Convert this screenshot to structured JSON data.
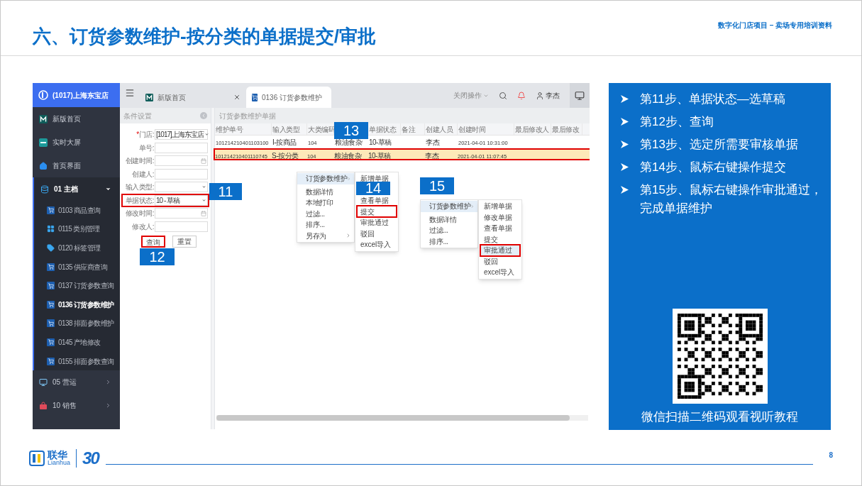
{
  "title": "六、订货参数维护-按分类的单据提交/审批",
  "header_note": "数字化门店项目 – 卖场专用培训资料",
  "screen": {
    "sidebar": {
      "store": "(1017)上海东宝店",
      "items": [
        {
          "label": "新版首页",
          "kind": "m"
        },
        {
          "label": "实时大屏",
          "kind": "screen"
        },
        {
          "label": "首页界面",
          "kind": "home"
        },
        {
          "label": "01 主档",
          "kind": "database",
          "expanded": true,
          "children": [
            {
              "label": "0103 商品查询",
              "kind": "cart",
              "selected": false
            },
            {
              "label": "0115 类别管理",
              "kind": "grid",
              "selected": false
            },
            {
              "label": "0120 标签管理",
              "kind": "tag",
              "selected": false
            },
            {
              "label": "0135 供应商查询",
              "kind": "cart",
              "selected": false
            },
            {
              "label": "0137 订货参数查询",
              "kind": "cart",
              "selected": false
            },
            {
              "label": "0136 订货参数维护",
              "kind": "cart",
              "selected": true
            },
            {
              "label": "0138 排面参数维护",
              "kind": "cart",
              "selected": false
            },
            {
              "label": "0145 产地修改",
              "kind": "cart",
              "selected": false
            },
            {
              "label": "0155 排面参数查询",
              "kind": "cart",
              "selected": false
            }
          ]
        },
        {
          "label": "05 营运",
          "kind": "monitor",
          "expanded": false
        },
        {
          "label": "10 销售",
          "kind": "sale",
          "expanded": false
        }
      ]
    },
    "tabs": [
      {
        "label": "新版首页",
        "kind": "m",
        "selected": false
      },
      {
        "label": "0136 订货参数维护",
        "kind": "cart",
        "selected": true
      }
    ],
    "toolbar": {
      "close_ops": "关闭操作",
      "user": "李杰"
    },
    "filter": {
      "title": "条件设置",
      "fields": [
        {
          "mark": "*",
          "label": "门店:",
          "kind": "select",
          "value": "[1017]上海东宝店",
          "outlined": false
        },
        {
          "label": "单号:",
          "kind": "text",
          "outlined": false
        },
        {
          "label": "创建时间:",
          "kind": "date",
          "outlined": false
        },
        {
          "label": "创建人:",
          "kind": "text",
          "outlined": false
        },
        {
          "label": "输入类型:",
          "kind": "select",
          "outlined": false
        },
        {
          "label": "单据状态:",
          "kind": "select",
          "value": "10 - 草稿",
          "outlined": true
        },
        {
          "label": "修改时间:",
          "kind": "date",
          "outlined": false
        },
        {
          "label": "修改人:",
          "kind": "text",
          "outlined": false
        }
      ],
      "buttons": [
        {
          "label": "查询",
          "outlined": true
        },
        {
          "label": "重置",
          "outlined": false
        }
      ]
    },
    "list": {
      "title": "订货参数维护单据",
      "columns": [
        {
          "label": "维护单号"
        },
        {
          "label": "输入类型"
        },
        {
          "label": "大类编码"
        },
        {
          "callout": "13"
        },
        {
          "label": "单据状态"
        },
        {
          "label": "备注"
        },
        {
          "label": "创建人员"
        },
        {
          "label": "创建时间"
        },
        {
          "label": "最后修改人"
        },
        {
          "label": "最后修改"
        }
      ],
      "rows": [
        {
          "no": "101214210401103100",
          "type": "I-按商品",
          "code": "104",
          "category": "粮油食杂",
          "status": "10-草稿",
          "creator": "李杰",
          "created": "2021-04-01 10:31:00",
          "selected": false
        },
        {
          "no": "101214210401110745",
          "type": "S-按分类",
          "code": "104",
          "category": "粮油食杂",
          "status": "10-草稿",
          "creator": "李杰",
          "created": "2021-04-01 11:07:45",
          "selected": true
        }
      ]
    },
    "menus": [
      {
        "items": [
          {
            "label": "订货参数维护",
            "submenu": true,
            "hovered": true
          },
          {
            "label": "数据详情",
            "submenu": false,
            "hovered": false
          },
          {
            "label": "本地打印",
            "submenu": false,
            "hovered": false
          },
          {
            "label": "过滤...",
            "submenu": false,
            "hovered": false
          },
          {
            "label": "排序...",
            "submenu": false,
            "hovered": false
          },
          {
            "label": "另存为",
            "submenu": true,
            "hovered": false
          }
        ],
        "subitems": [
          {
            "label": "新增单据",
            "outlined": false
          },
          {
            "callout": "14"
          },
          {
            "label": "查看单据",
            "outlined": false
          },
          {
            "label": "提交",
            "outlined": true
          },
          {
            "label": "审批通过",
            "outlined": false
          },
          {
            "label": "驳回",
            "outlined": false
          },
          {
            "label": "excel导入",
            "outlined": false
          }
        ]
      },
      {
        "items": [
          {
            "label": "订货参数维护",
            "submenu": true,
            "hovered": true
          },
          {
            "label": "数据详情",
            "submenu": false,
            "hovered": false
          },
          {
            "label": "过滤...",
            "submenu": false,
            "hovered": false
          },
          {
            "label": "排序...",
            "submenu": false,
            "hovered": false
          }
        ],
        "subitems": [
          {
            "label": "新增单据",
            "outlined": false
          },
          {
            "label": "修改单据",
            "outlined": false
          },
          {
            "label": "查看单据",
            "outlined": false
          },
          {
            "label": "提交",
            "outlined": false
          },
          {
            "label": "审批通过",
            "outlined": true
          },
          {
            "label": "驳回",
            "outlined": false
          },
          {
            "label": "excel导入",
            "outlined": false
          }
        ]
      }
    ],
    "callouts": [
      "11",
      "12",
      "15"
    ]
  },
  "steps": [
    "第11步、单据状态—选草稿",
    "第12步、查询",
    "第13步、选定所需要审核单据",
    "第14步、鼠标右键操作提交",
    "第15步、鼠标右键操作审批通过，完成单据维护"
  ],
  "qr_caption": "微信扫描二维码观看视听教程",
  "footer": {
    "brand": "联华",
    "brand_en": "Lianhua",
    "anniversary": "30",
    "page": "8"
  }
}
